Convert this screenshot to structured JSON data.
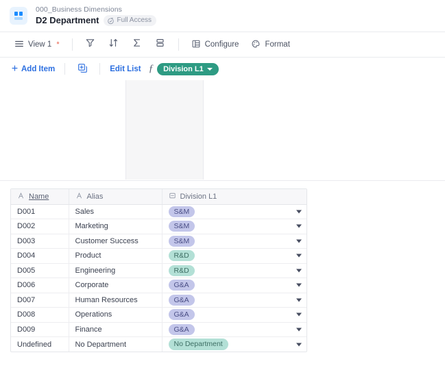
{
  "header": {
    "app_icon": "grid-app-icon",
    "breadcrumb": "000_Business Dimensions",
    "title": "D2 Department",
    "access_badge": {
      "label": "Full Access",
      "icon": "access-shield-icon"
    }
  },
  "toolbar": {
    "menu_icon": "hamburger-menu-icon",
    "view_label": "View 1",
    "view_modified_marker": "*",
    "icons": [
      {
        "name": "filter-icon",
        "tooltip": "Filter"
      },
      {
        "name": "sort-icon",
        "tooltip": "Sort"
      },
      {
        "name": "sum-icon",
        "tooltip": "Aggregate"
      },
      {
        "name": "group-icon",
        "tooltip": "Group"
      }
    ],
    "configure_label": "Configure",
    "configure_icon": "table-configure-icon",
    "format_label": "Format",
    "format_icon": "palette-icon"
  },
  "actionbar": {
    "add_item_label": "Add Item",
    "add_item_icon": "plus-icon",
    "duplicate_icon": "duplicate-plus-icon",
    "edit_list_label": "Edit List",
    "formula_icon": "fx-icon",
    "field_chip": {
      "label": "Division L1",
      "caret": "chevron-down-icon",
      "color": "#2e9b83"
    }
  },
  "table": {
    "columns": [
      {
        "label": "Name",
        "type_icon": "text-type-icon",
        "underlined": true
      },
      {
        "label": "Alias",
        "type_icon": "text-type-icon",
        "underlined": false
      },
      {
        "label": "Division L1",
        "type_icon": "select-type-icon",
        "underlined": false
      }
    ],
    "rows": [
      {
        "name": "D001",
        "alias": "Sales",
        "division": "S&M",
        "division_style": "purple"
      },
      {
        "name": "D002",
        "alias": "Marketing",
        "division": "S&M",
        "division_style": "purple"
      },
      {
        "name": "D003",
        "alias": "Customer Success",
        "division": "S&M",
        "division_style": "purple"
      },
      {
        "name": "D004",
        "alias": "Product",
        "division": "R&D",
        "division_style": "teal"
      },
      {
        "name": "D005",
        "alias": "Engineering",
        "division": "R&D",
        "division_style": "teal"
      },
      {
        "name": "D006",
        "alias": "Corporate",
        "division": "G&A",
        "division_style": "purple"
      },
      {
        "name": "D007",
        "alias": "Human Resources",
        "division": "G&A",
        "division_style": "purple"
      },
      {
        "name": "D008",
        "alias": "Operations",
        "division": "G&A",
        "division_style": "purple"
      },
      {
        "name": "D009",
        "alias": "Finance",
        "division": "G&A",
        "division_style": "purple"
      },
      {
        "name": "Undefined",
        "alias": "No Department",
        "division": "No Department",
        "division_style": "teal"
      }
    ]
  },
  "colors": {
    "pill_purple_bg": "#c3c6ea",
    "pill_purple_text": "#4b4f86",
    "pill_teal_bg": "#b3e0d6",
    "pill_teal_text": "#3e6e64",
    "chip_green": "#2e9b83",
    "link_blue": "#2c6fe0",
    "star_red": "#e8604c"
  }
}
